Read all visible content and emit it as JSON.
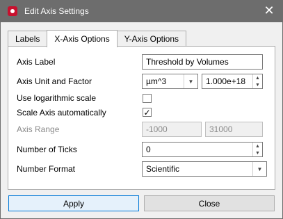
{
  "window": {
    "title": "Edit Axis Settings",
    "close_glyph": "✕"
  },
  "tabs": [
    {
      "label": "Labels",
      "active": false
    },
    {
      "label": "X-Axis Options",
      "active": true
    },
    {
      "label": "Y-Axis Options",
      "active": false
    }
  ],
  "form": {
    "axis_label": {
      "label": "Axis Label",
      "value": "Threshold by Volumes"
    },
    "axis_unit": {
      "label": "Axis Unit and Factor",
      "unit": "µm^3",
      "factor": "1.000e+18"
    },
    "log_scale": {
      "label": "Use logarithmic scale",
      "checked": false
    },
    "auto_scale": {
      "label": "Scale Axis automatically",
      "checked": true,
      "check_glyph": "✓"
    },
    "axis_range": {
      "label": "Axis Range",
      "min": "-1000",
      "max": "31000",
      "disabled": true
    },
    "ticks": {
      "label": "Number of Ticks",
      "value": "0"
    },
    "number_format": {
      "label": "Number Format",
      "value": "Scientific"
    }
  },
  "buttons": {
    "apply": "Apply",
    "close": "Close"
  },
  "glyphs": {
    "up": "▲",
    "down": "▼"
  },
  "colors": {
    "titlebar": "#6d6d6d",
    "accent": "#0078d7",
    "app_icon": "#c8102e"
  }
}
